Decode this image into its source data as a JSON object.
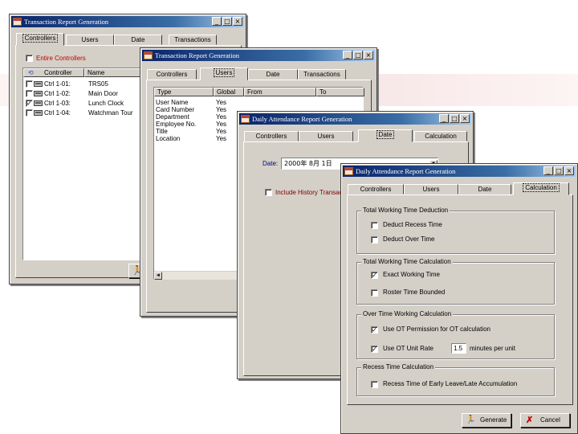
{
  "win1": {
    "title": "Transaction Report Generation",
    "tabs": [
      "Controllers",
      "Users",
      "Date",
      "Transactions"
    ],
    "entire_label": "Entire Controllers",
    "columns": [
      "Controller",
      "Name"
    ],
    "rows": [
      {
        "id": "Ctrl 1-01:",
        "name": "TRS05",
        "checked": false
      },
      {
        "id": "Ctrl 1-02:",
        "name": "Main Door",
        "checked": false
      },
      {
        "id": "Ctrl 1-03:",
        "name": "Lunch Clock",
        "checked": true
      },
      {
        "id": "Ctrl 1-04:",
        "name": "Watchman Tour",
        "checked": false
      }
    ]
  },
  "win2": {
    "title": "Transaction Report Generation",
    "tabs": [
      "Controllers",
      "Users",
      "Date",
      "Transactions"
    ],
    "columns": [
      "Type",
      "Global",
      "From",
      "To"
    ],
    "rows": [
      {
        "type": "User Name",
        "global": "Yes"
      },
      {
        "type": "Card Number",
        "global": "Yes"
      },
      {
        "type": "Department",
        "global": "Yes"
      },
      {
        "type": "Employee No.",
        "global": "Yes"
      },
      {
        "type": "Title",
        "global": "Yes"
      },
      {
        "type": "Location",
        "global": "Yes"
      }
    ]
  },
  "win3": {
    "title": "Daily Attendance Report Generation",
    "tabs": [
      "Controllers",
      "Users",
      "Date",
      "Calculation"
    ],
    "date_label": "Date:",
    "date_value": "2000年  8月  1日",
    "history_label": "Include History Transac"
  },
  "win4": {
    "title": "Daily Attendance Report Generation",
    "tabs": [
      "Controllers",
      "Users",
      "Date",
      "Calculation"
    ],
    "groups": [
      {
        "title": "Total Working Time Deduction",
        "options": [
          {
            "label": "Deduct Recess Time",
            "checked": false
          },
          {
            "label": "Deduct Over Time",
            "checked": false
          }
        ]
      },
      {
        "title": "Total Working Time Calculation",
        "options": [
          {
            "label": "Exact Working Time",
            "checked": true
          },
          {
            "label": "Roster Time Bounded",
            "checked": false
          }
        ]
      },
      {
        "title": "Over Time Working Calculation",
        "options": [
          {
            "label": "Use OT Permission for OT calculation",
            "checked": true
          },
          {
            "label": "Use OT Unit Rate",
            "checked": true
          }
        ]
      },
      {
        "title": "Recess Time Calculation",
        "options": [
          {
            "label": "Recess Time of Early Leave/Late Accumulation",
            "checked": false
          }
        ]
      }
    ],
    "ot_rate_value": "1.5",
    "ot_rate_unit": "minutes per unit",
    "generate_label": "Generate",
    "cancel_label": "Cancel"
  },
  "colors": {
    "titlebar": "#0a246a",
    "accent_red": "#c00000",
    "date_label": "#000080"
  },
  "icons": [
    "window-app-icon",
    "minimize-icon",
    "maximize-icon",
    "close-icon",
    "controller-icon",
    "run-icon",
    "cancel-x-icon"
  ]
}
